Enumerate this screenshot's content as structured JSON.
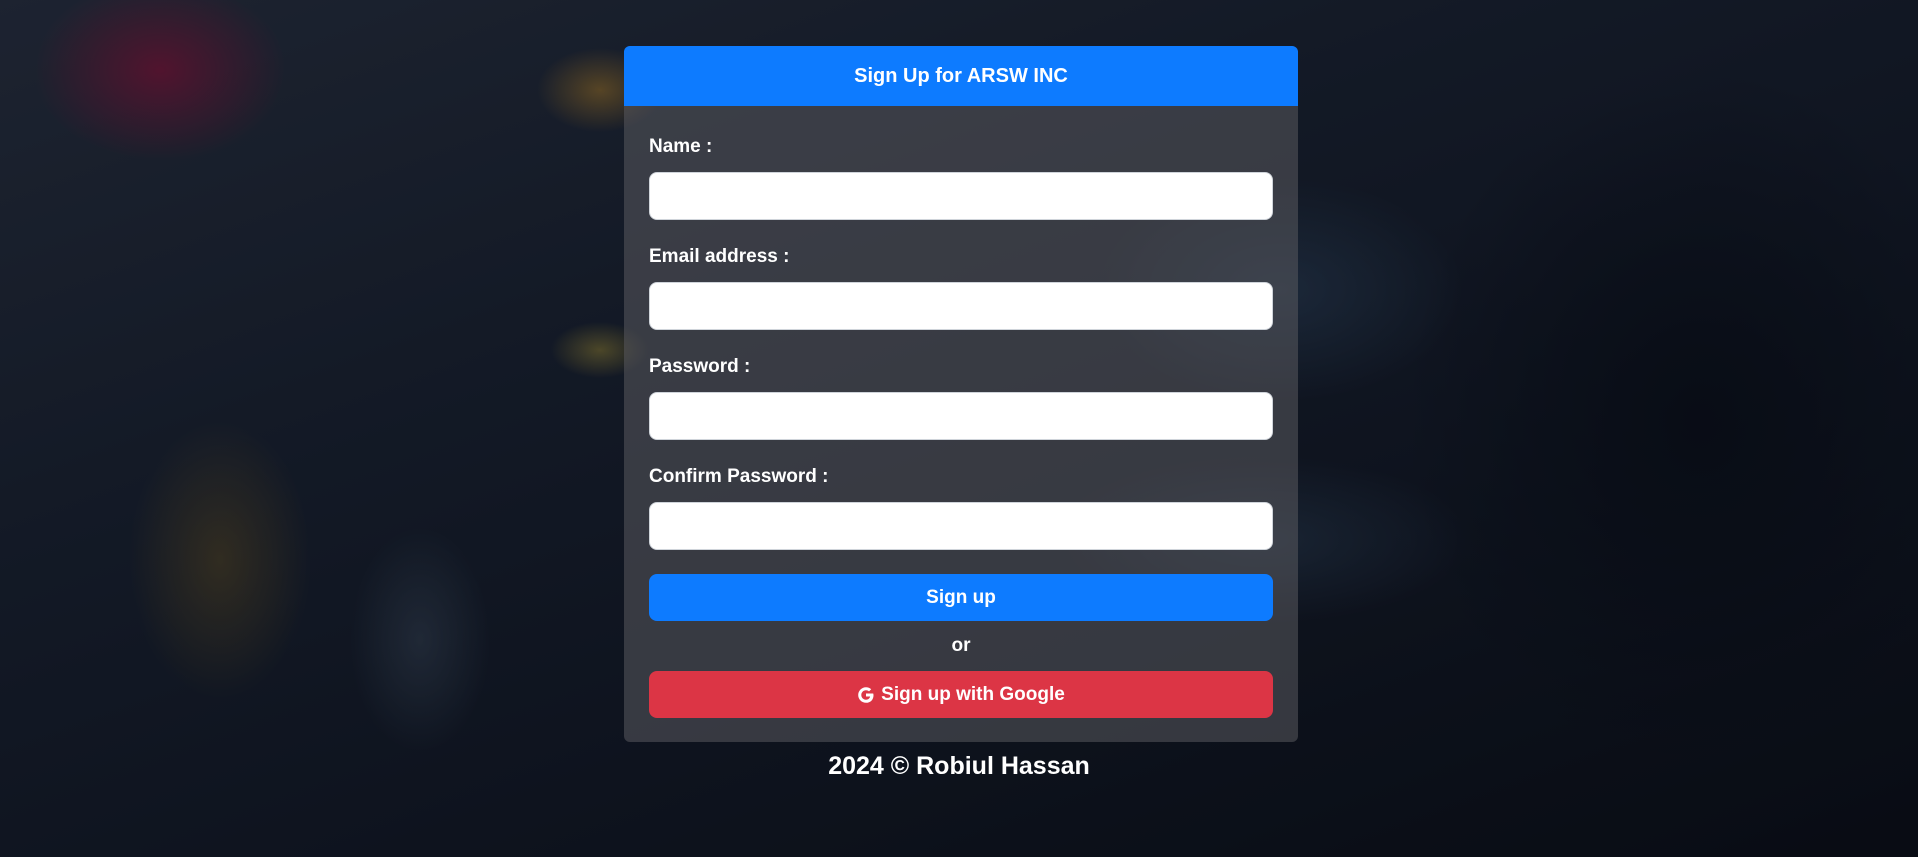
{
  "form": {
    "title": "Sign Up for ARSW INC",
    "fields": {
      "name": {
        "label": "Name :",
        "value": "",
        "placeholder": ""
      },
      "email": {
        "label": "Email address :",
        "value": "",
        "placeholder": ""
      },
      "password": {
        "label": "Password :",
        "value": "",
        "placeholder": ""
      },
      "confirm_password": {
        "label": "Confirm Password :",
        "value": "",
        "placeholder": ""
      }
    },
    "signup_label": "Sign up",
    "or_text": "or",
    "google_label": "Sign up with Google",
    "google_icon": "google-g-icon"
  },
  "footer": {
    "text": "2024 © Robiul Hassan"
  },
  "colors": {
    "primary": "#0d7bff",
    "danger": "#dc3545",
    "text": "#ffffff"
  }
}
